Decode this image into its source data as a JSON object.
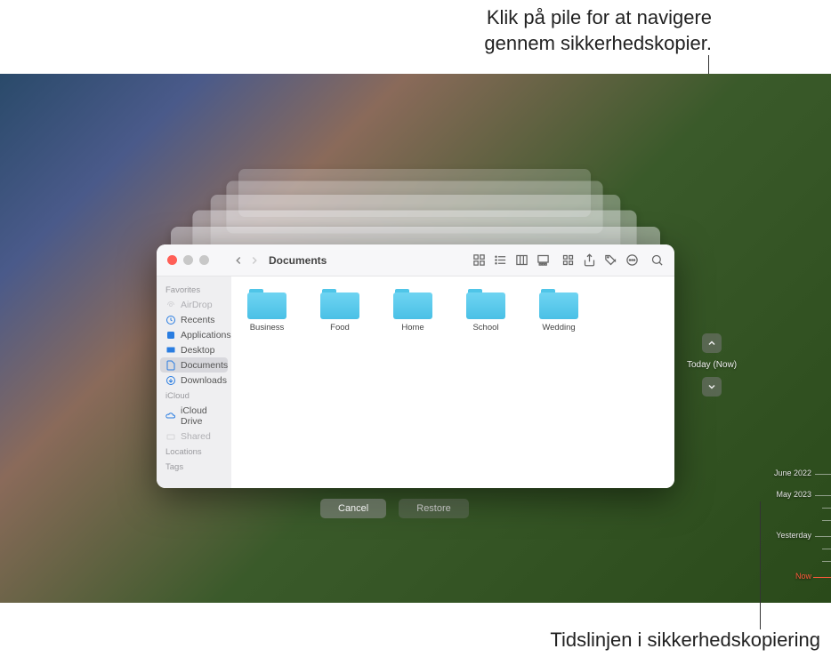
{
  "callouts": {
    "top_line1": "Klik på pile for at navigere",
    "top_line2": "gennem sikkerhedskopier.",
    "bottom": "Tidslinjen i sikkerhedskopiering"
  },
  "finder": {
    "title": "Documents",
    "sidebar": {
      "favorites_head": "Favorites",
      "airdrop": "AirDrop",
      "recents": "Recents",
      "applications": "Applications",
      "desktop": "Desktop",
      "documents": "Documents",
      "downloads": "Downloads",
      "icloud_head": "iCloud",
      "icloud_drive": "iCloud Drive",
      "shared": "Shared",
      "locations_head": "Locations",
      "tags_head": "Tags"
    },
    "folders": [
      {
        "name": "Business"
      },
      {
        "name": "Food"
      },
      {
        "name": "Home"
      },
      {
        "name": "School"
      },
      {
        "name": "Wedding"
      }
    ]
  },
  "nav": {
    "current": "Today (Now)"
  },
  "buttons": {
    "cancel": "Cancel",
    "restore": "Restore"
  },
  "timeline": {
    "t0": "June 2022",
    "t1": "May 2023",
    "t2": "Yesterday",
    "t3": "Now"
  }
}
